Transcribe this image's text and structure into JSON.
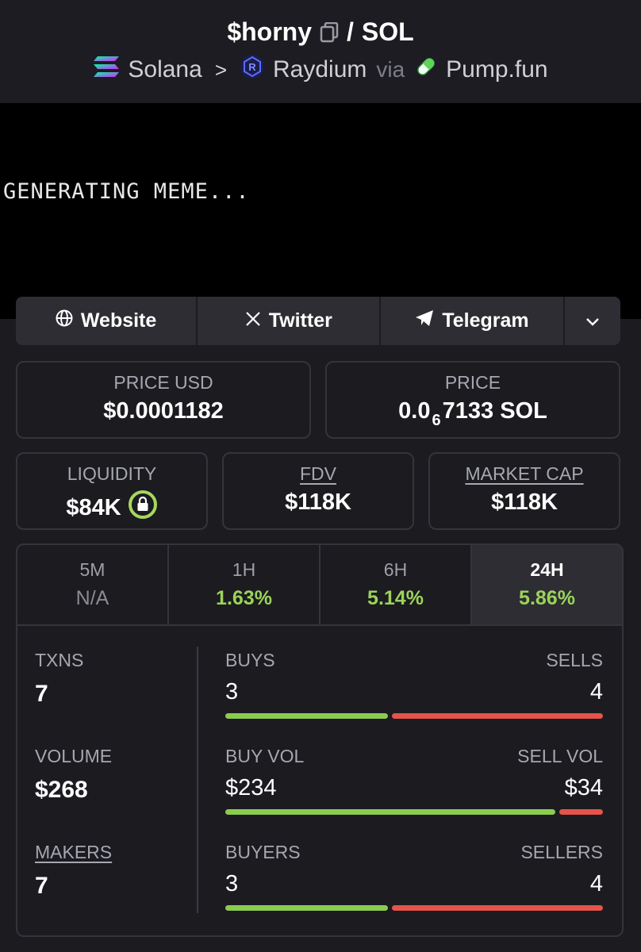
{
  "header": {
    "token": "$horny",
    "slash": "/",
    "quote": "SOL",
    "chain": "Solana",
    "dex": "Raydium",
    "via": "via",
    "launchpad": "Pump.fun",
    "icons": [
      "copy-icon",
      "solana-logo-icon",
      "raydium-logo-icon",
      "pill-icon",
      "chevron-right-icon"
    ]
  },
  "meme": {
    "text": "GENERATING MEME..."
  },
  "links": {
    "website": "Website",
    "twitter": "Twitter",
    "telegram": "Telegram",
    "icons": [
      "globe-icon",
      "x-logo-icon",
      "telegram-icon",
      "chevron-down-icon"
    ]
  },
  "stats": {
    "price_usd_label": "PRICE USD",
    "price_usd": "$0.0001182",
    "price_label": "PRICE",
    "price_prefix": "0.0",
    "price_zeros": "6",
    "price_rest": "7133 SOL",
    "liquidity_label": "LIQUIDITY",
    "liquidity": "$84K",
    "fdv_label": "FDV",
    "fdv": "$118K",
    "mcap_label": "MARKET CAP",
    "mcap": "$118K"
  },
  "tabs": [
    {
      "label": "5M",
      "value": "N/A"
    },
    {
      "label": "1H",
      "value": "1.63%"
    },
    {
      "label": "6H",
      "value": "5.14%"
    },
    {
      "label": "24H",
      "value": "5.86%"
    }
  ],
  "metrics": {
    "txns_label": "TXNS",
    "txns": "7",
    "volume_label": "VOLUME",
    "volume": "$268",
    "makers_label": "MAKERS",
    "makers": "7"
  },
  "bars": {
    "buys_label": "BUYS",
    "sells_label": "SELLS",
    "buys": "3",
    "sells": "4",
    "buy_vol_label": "BUY VOL",
    "sell_vol_label": "SELL VOL",
    "buy_vol": "$234",
    "sell_vol": "$34",
    "buyers_label": "BUYERS",
    "sellers_label": "SELLERS",
    "buyers": "3",
    "sellers": "4",
    "txn_buy_fraction": 0.43,
    "vol_buy_fraction": 0.873,
    "maker_buy_fraction": 0.43
  },
  "colors": {
    "positive": "#9bd35a",
    "buy_bar": "#8ccb4f",
    "sell_bar": "#e5534b",
    "lock_green": "#a7d65f"
  }
}
